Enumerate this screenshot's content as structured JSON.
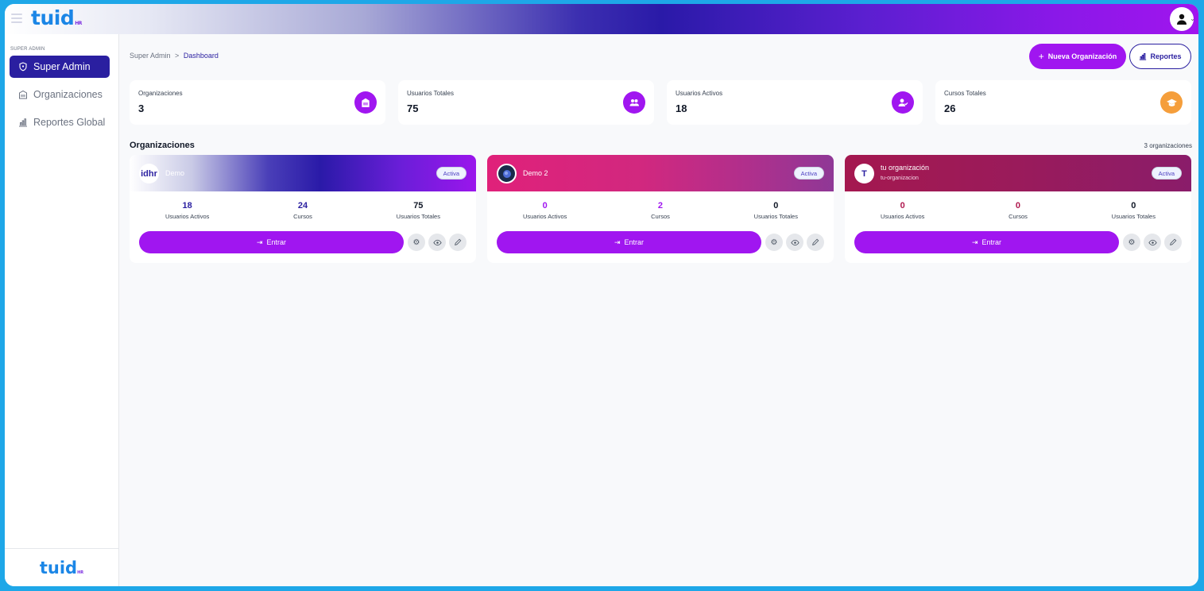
{
  "app": {
    "logo": "tuid",
    "logo_sub": "HR"
  },
  "sidebar": {
    "section": "SUPER ADMIN",
    "items": [
      {
        "label": "Super Admin",
        "icon": "shield-icon"
      },
      {
        "label": "Organizaciones",
        "icon": "building-icon"
      },
      {
        "label": "Reportes Global",
        "icon": "bar-chart-icon"
      }
    ],
    "footer_logo": "tuid",
    "footer_logo_sub": "HR"
  },
  "breadcrumb": {
    "root": "Super Admin",
    "sep": ">",
    "current": "Dashboard"
  },
  "actions": {
    "new_org": "Nueva Organización",
    "reports": "Reportes"
  },
  "stats": [
    {
      "label": "Organizaciones",
      "value": "3",
      "icon": "building-icon"
    },
    {
      "label": "Usuarios Totales",
      "value": "75",
      "icon": "users-icon"
    },
    {
      "label": "Usuarios Activos",
      "value": "18",
      "icon": "user-check-icon"
    },
    {
      "label": "Cursos Totales",
      "value": "26",
      "icon": "graduation-cap-icon"
    }
  ],
  "orgs_section": {
    "title": "Organizaciones",
    "count": "3 organizaciones"
  },
  "orgs": [
    {
      "avatar": "idhr",
      "name": "Demo",
      "slug": "",
      "status": "Activa",
      "metrics": [
        {
          "value": "18",
          "label": "Usuarios Activos"
        },
        {
          "value": "24",
          "label": "Cursos"
        },
        {
          "value": "75",
          "label": "Usuarios Totales"
        }
      ],
      "enter": "Entrar"
    },
    {
      "avatar": "",
      "name": "Demo 2",
      "slug": "",
      "status": "Activa",
      "metrics": [
        {
          "value": "0",
          "label": "Usuarios Activos"
        },
        {
          "value": "2",
          "label": "Cursos"
        },
        {
          "value": "0",
          "label": "Usuarios Totales"
        }
      ],
      "enter": "Entrar"
    },
    {
      "avatar": "T",
      "name": "tu organización",
      "slug": "tu-organizacion",
      "status": "Activa",
      "metrics": [
        {
          "value": "0",
          "label": "Usuarios Activos"
        },
        {
          "value": "0",
          "label": "Cursos"
        },
        {
          "value": "0",
          "label": "Usuarios Totales"
        }
      ],
      "enter": "Entrar"
    }
  ],
  "colors": {
    "accent": "#a016f0",
    "primary": "#2a1fa0",
    "logo": "#1b86e6",
    "orange": "#f59e3b"
  }
}
